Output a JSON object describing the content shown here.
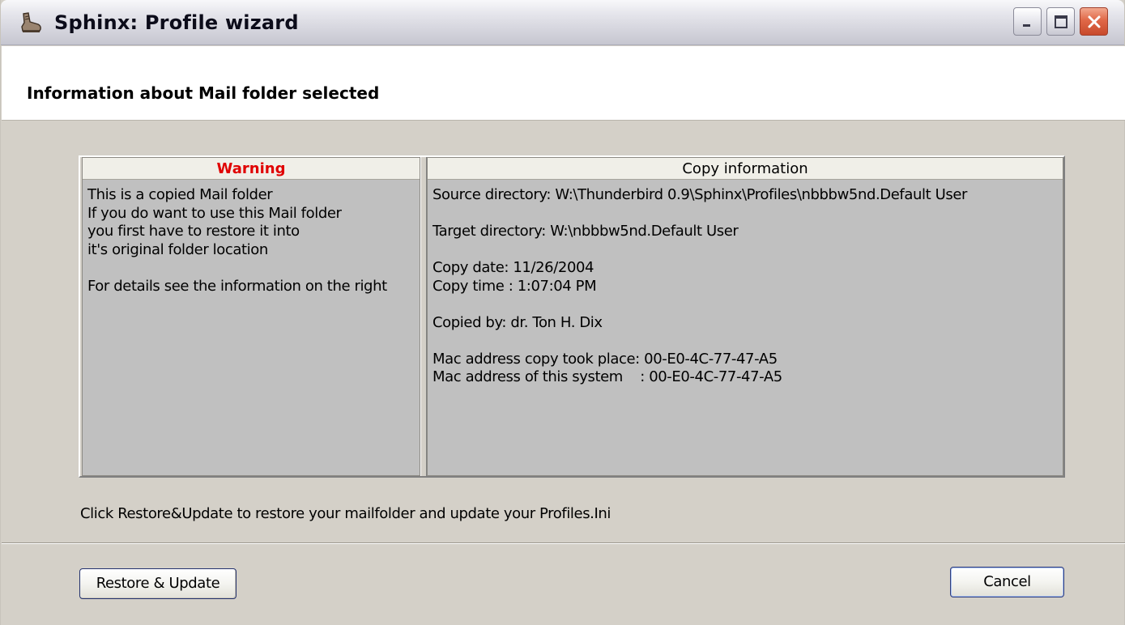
{
  "window": {
    "title": "Sphinx: Profile wizard",
    "icon": "boot-icon",
    "controls": [
      "minimize-icon",
      "maximize-icon",
      "close-icon"
    ]
  },
  "header": {
    "title": "Information about Mail folder selected"
  },
  "warning_panel": {
    "heading": "Warning",
    "heading_color": "#e00000",
    "text": "This is a copied Mail folder\nIf you do want to use this Mail folder\nyou first have to restore it into\nit's original folder location\n\nFor details see the information on the right"
  },
  "copy_panel": {
    "heading": "Copy information",
    "text": "Source directory: W:\\Thunderbird 0.9\\Sphinx\\Profiles\\nbbbw5nd.Default User\n\nTarget directory: W:\\nbbbw5nd.Default User\n\nCopy date: 11/26/2004\nCopy time : 1:07:04 PM\n\nCopied by: dr. Ton H. Dix\n\nMac address copy took place: 00-E0-4C-77-47-A5\nMac address of this system    : 00-E0-4C-77-47-A5"
  },
  "instruction": "Click Restore&Update to restore your mailfolder and update your Profiles.Ini",
  "buttons": {
    "restore": "Restore & Update",
    "cancel": "Cancel"
  }
}
